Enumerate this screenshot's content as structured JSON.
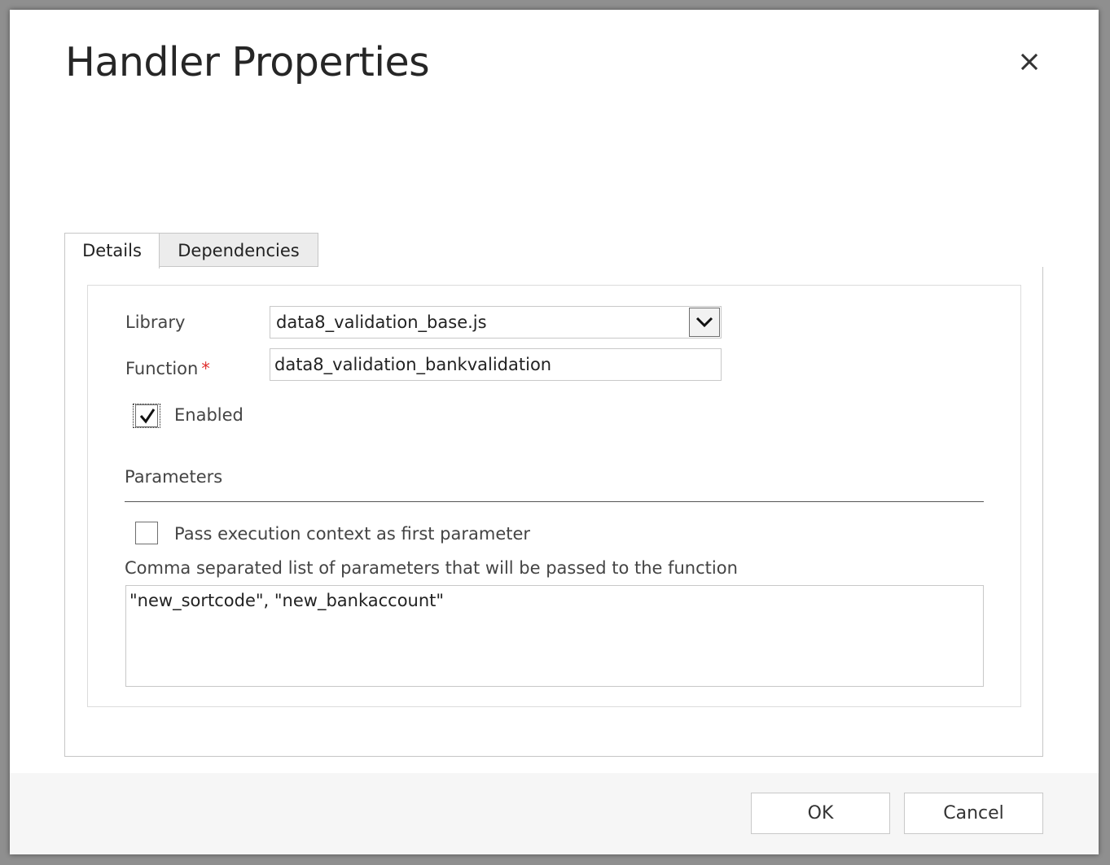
{
  "dialog": {
    "title": "Handler Properties",
    "close_icon": "close-icon"
  },
  "tabs": [
    {
      "label": "Details",
      "selected": true
    },
    {
      "label": "Dependencies",
      "selected": false
    }
  ],
  "details": {
    "library_label": "Library",
    "library_value": "data8_validation_base.js",
    "library_dropdown_icon": "chevron-down-icon",
    "function_label": "Function",
    "function_required_marker": "*",
    "function_value": "data8_validation_bankvalidation",
    "enabled_label": "Enabled",
    "enabled_checked": true
  },
  "parameters": {
    "heading": "Parameters",
    "pass_context_label": "Pass execution context as first parameter",
    "pass_context_checked": false,
    "list_label": "Comma separated list of parameters that will be passed to the function",
    "list_value": "\"new_sortcode\", \"new_bankaccount\""
  },
  "footer": {
    "ok_label": "OK",
    "cancel_label": "Cancel"
  },
  "colors": {
    "required": "#e0302e",
    "footer_bg": "#f6f6f6",
    "overlay": "#8f8f8f"
  }
}
